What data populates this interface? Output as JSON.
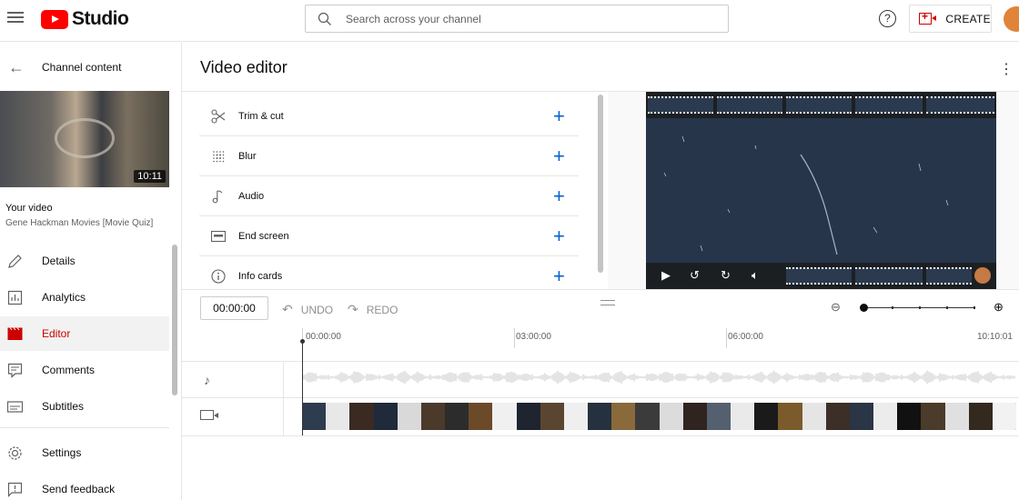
{
  "header": {
    "logo_text": "Studio",
    "search_placeholder": "Search across your channel",
    "help_label": "?",
    "create_label": "CREATE"
  },
  "sidebar": {
    "back_title": "Channel content",
    "thumbnail_duration": "10:11",
    "your_video_label": "Your video",
    "video_title": "Gene Hackman Movies [Movie Quiz]",
    "items": [
      {
        "label": "Details",
        "icon": "pencil-icon"
      },
      {
        "label": "Analytics",
        "icon": "analytics-icon"
      },
      {
        "label": "Editor",
        "icon": "clapperboard-icon",
        "active": true
      },
      {
        "label": "Comments",
        "icon": "comments-icon"
      },
      {
        "label": "Subtitles",
        "icon": "subtitles-icon"
      }
    ],
    "footer_items": [
      {
        "label": "Settings",
        "icon": "gear-icon"
      },
      {
        "label": "Send feedback",
        "icon": "feedback-icon"
      }
    ]
  },
  "editor": {
    "title": "Video editor",
    "tools": [
      {
        "label": "Trim & cut",
        "icon": "scissors-icon"
      },
      {
        "label": "Blur",
        "icon": "blur-icon"
      },
      {
        "label": "Audio",
        "icon": "music-note-icon"
      },
      {
        "label": "End screen",
        "icon": "end-screen-icon"
      },
      {
        "label": "Info cards",
        "icon": "info-icon"
      }
    ],
    "add_symbol": "+",
    "timecode": "00:00:00",
    "undo_label": "UNDO",
    "redo_label": "REDO",
    "zoom_level": 0.0,
    "timeline_ticks": [
      "00:00:00",
      "03:00:00",
      "06:00:00",
      "10:10:01"
    ]
  },
  "colors": {
    "brand_red": "#ff0000",
    "active_red": "#cc0000",
    "accent_blue": "#065fd4"
  }
}
